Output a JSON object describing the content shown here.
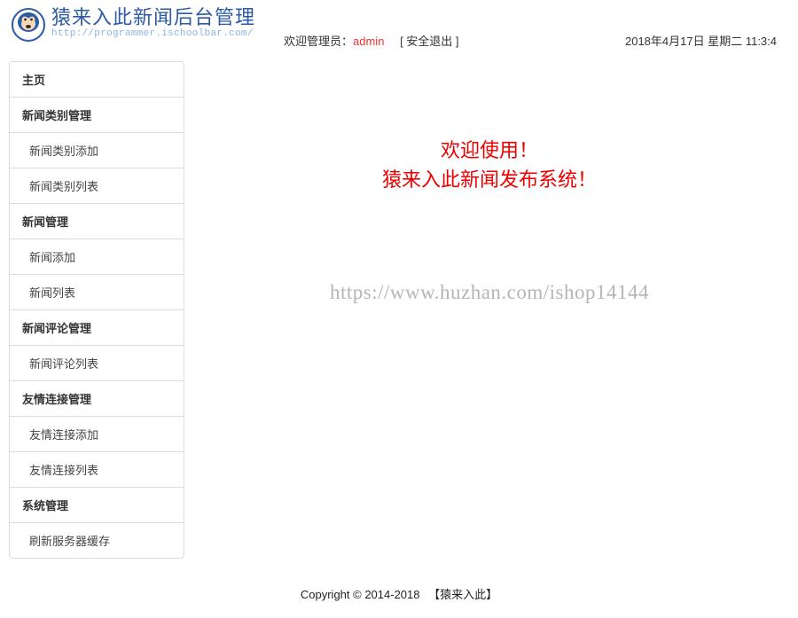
{
  "header": {
    "title": "猿来入此新闻后台管理",
    "url": "http://programmer.ischoolbar.com/",
    "welcome_prefix": "欢迎管理员：",
    "admin_name": "admin",
    "logout_label": "安全退出",
    "datetime": "2018年4月17日 星期二 11:3:4"
  },
  "sidebar": {
    "home": "主页",
    "groups": [
      {
        "header": "新闻类别管理",
        "items": [
          "新闻类别添加",
          "新闻类别列表"
        ]
      },
      {
        "header": "新闻管理",
        "items": [
          "新闻添加",
          "新闻列表"
        ]
      },
      {
        "header": "新闻评论管理",
        "items": [
          "新闻评论列表"
        ]
      },
      {
        "header": "友情连接管理",
        "items": [
          "友情连接添加",
          "友情连接列表"
        ]
      },
      {
        "header": "系统管理",
        "items": [
          "刷新服务器缓存"
        ]
      }
    ]
  },
  "content": {
    "welcome_line1": "欢迎使用！",
    "welcome_line2": "猿来入此新闻发布系统！",
    "watermark": "https://www.huzhan.com/ishop14144"
  },
  "footer": {
    "copyright": "Copyright © 2014-2018",
    "brand": "【猿来入此】"
  }
}
